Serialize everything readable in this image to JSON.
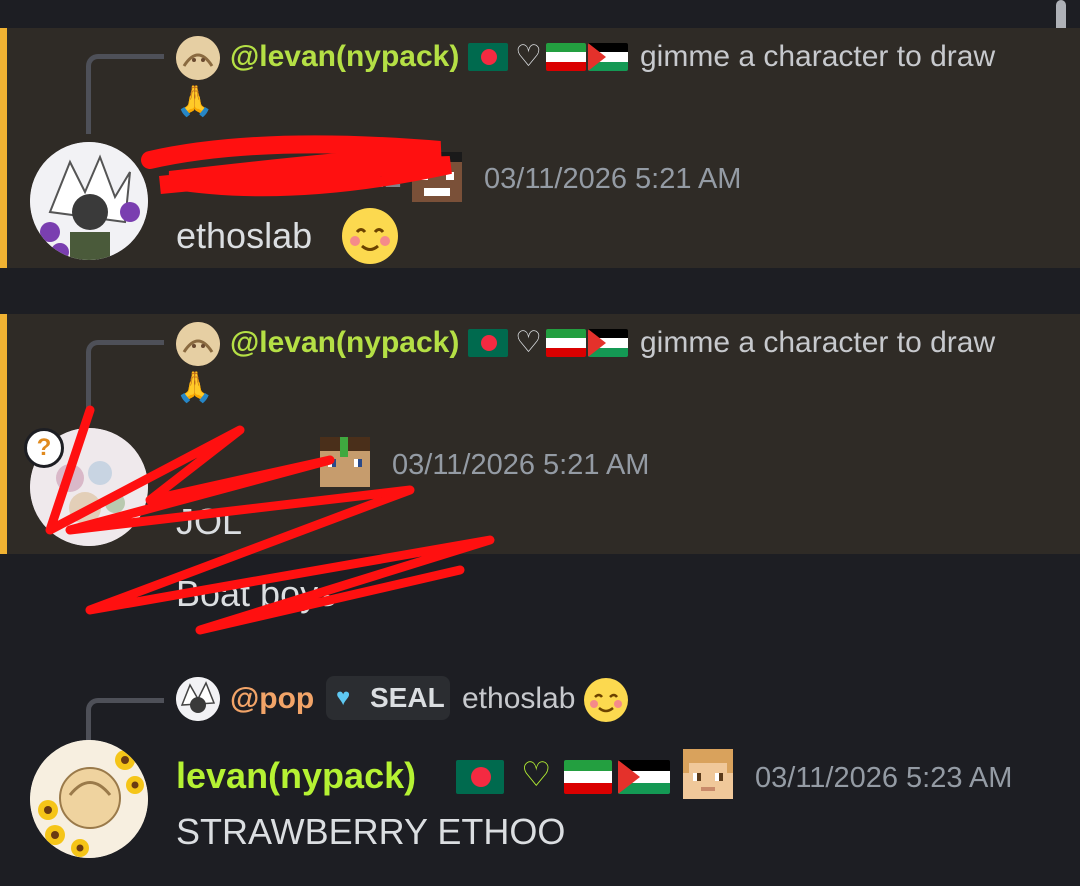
{
  "messages": [
    {
      "reply": {
        "mention": "@levan(nypack)",
        "heart": "♡",
        "text": "gimme a character to draw"
      },
      "author": {
        "tag_fragment": "EAL"
      },
      "timestamp": "03/11/2026 5:21 AM",
      "content": "ethoslab"
    },
    {
      "reply": {
        "mention": "@levan(nypack)",
        "heart": "♡",
        "text": "gimme a character to draw"
      },
      "avatar_badge": "?",
      "timestamp": "03/11/2026 5:21 AM",
      "content": "JOL",
      "followup": "Boat boys"
    },
    {
      "reply": {
        "mention": "@pop",
        "tag": "SEAL",
        "text": "ethoslab"
      },
      "author": {
        "name": "levan(nypack)",
        "heart": "♡"
      },
      "timestamp": "03/11/2026 5:23 AM",
      "content": "STRAWBERRY ETHOO"
    }
  ],
  "colors": {
    "background": "#1d1e23",
    "highlight": "#2f2b26",
    "highlight_bar": "#f0b232",
    "mention": "#b5e045",
    "pop_name": "#f2a468",
    "author_name": "#b5f233",
    "timestamp": "#949ba4",
    "scribble": "#ff1010"
  }
}
